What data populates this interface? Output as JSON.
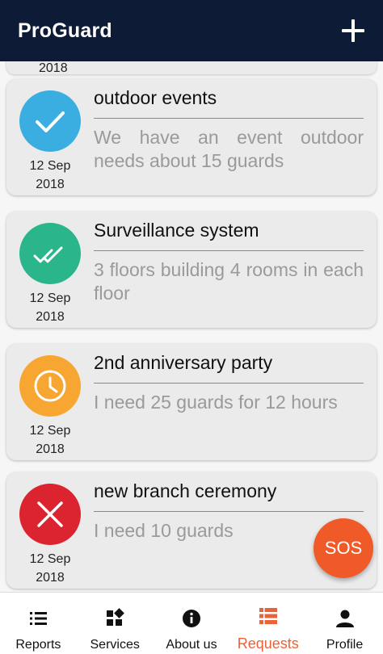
{
  "appbar": {
    "title": "ProGuard"
  },
  "peek": {
    "date_fragment": "2018"
  },
  "requests": [
    {
      "title": "outdoor events",
      "desc": "We have an event outdoor needs about 15 guards",
      "day": "12 Sep",
      "year": "2018",
      "status": "check-icon",
      "color": "#3aaee0"
    },
    {
      "title": "Surveillance system",
      "desc": "3 floors building 4 rooms in each floor",
      "day": "12 Sep",
      "year": "2018",
      "status": "double-check-icon",
      "color": "#2bb58a"
    },
    {
      "title": "2nd anniversary party",
      "desc": "I need 25 guards for 12 hours",
      "day": "12 Sep",
      "year": "2018",
      "status": "clock-icon",
      "color": "#f7a632"
    },
    {
      "title": "new branch ceremony",
      "desc": "I need 10 guards",
      "day": "12 Sep",
      "year": "2018",
      "status": "x-icon",
      "color": "#dc2430"
    }
  ],
  "sos": {
    "label": "SOS",
    "color": "#f05a28"
  },
  "nav": [
    {
      "label": "Reports",
      "icon": "list-icon"
    },
    {
      "label": "Services",
      "icon": "grid-icon"
    },
    {
      "label": "About us",
      "icon": "info-icon"
    },
    {
      "label": "Requests",
      "icon": "table-icon",
      "active": true
    },
    {
      "label": "Profile",
      "icon": "person-icon"
    }
  ],
  "colors": {
    "appbar": "#0d1b36",
    "accent": "#e8633a"
  }
}
